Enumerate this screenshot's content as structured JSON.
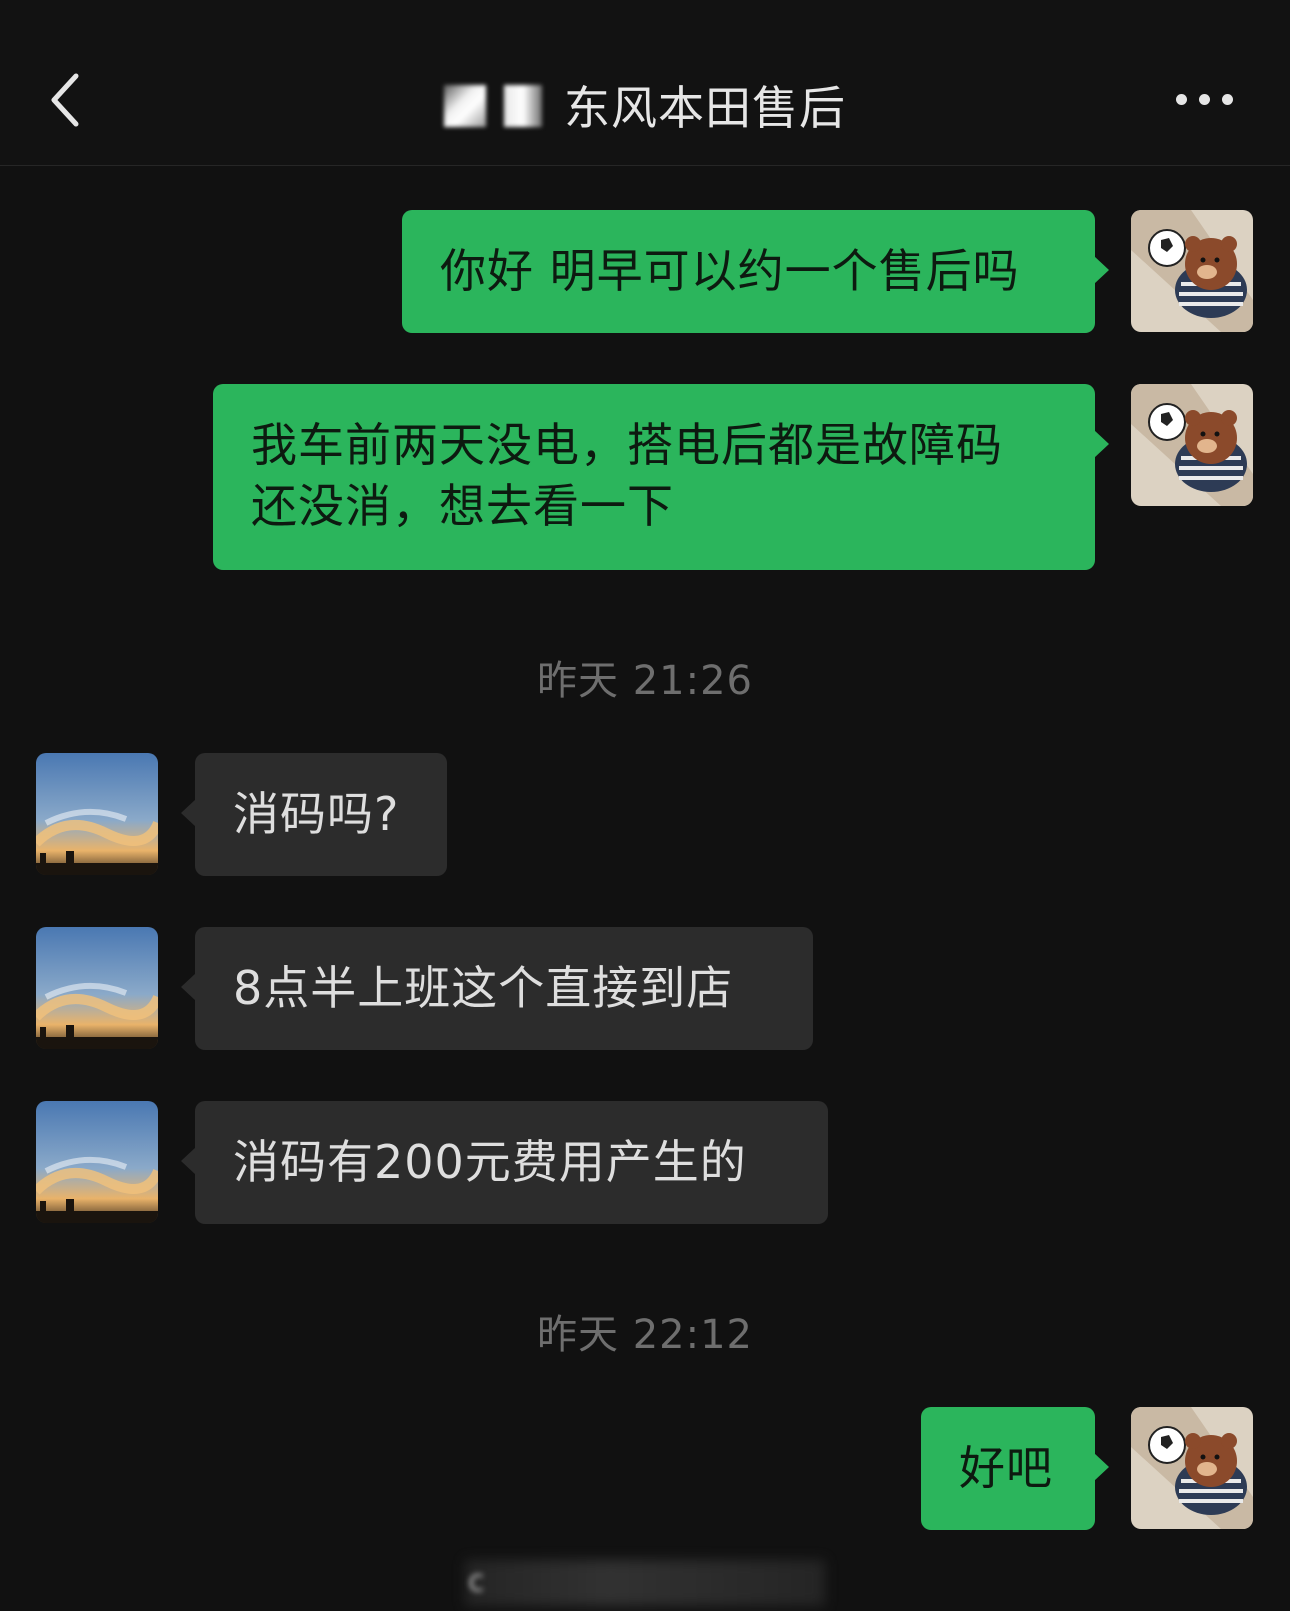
{
  "header": {
    "title": "东风本田售后",
    "back_icon": "chevron-left-icon",
    "more_icon": "more-horizontal-icon"
  },
  "messages": [
    {
      "side": "out",
      "text": "你好 明早可以约一个售后吗"
    },
    {
      "side": "out",
      "text": "我车前两天没电，搭电后都是故障码\n还没消，想去看一下"
    },
    {
      "type": "time",
      "text": "昨天 21:26"
    },
    {
      "side": "in",
      "text": "消码吗?"
    },
    {
      "side": "in",
      "text": "8点半上班这个直接到店"
    },
    {
      "side": "in",
      "text": "消码有200元费用产生的"
    },
    {
      "type": "time",
      "text": "昨天 22:12"
    },
    {
      "side": "out",
      "text": "好吧"
    }
  ],
  "footer": {
    "obscured_text": "c"
  },
  "colors": {
    "background": "#111111",
    "outgoing_bubble": "#2bb55c",
    "incoming_bubble": "#2c2c2c",
    "timestamp": "#6e6e6e"
  }
}
